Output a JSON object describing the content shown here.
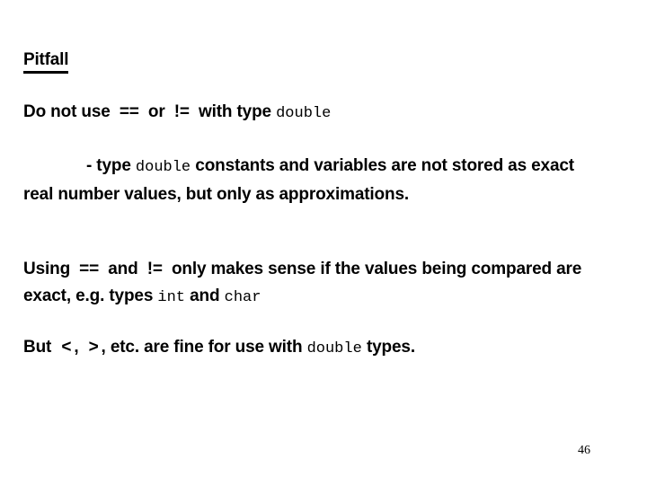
{
  "slide": {
    "heading": "Pitfall",
    "page_number": "46",
    "background_color": "#ffffff",
    "text_color": "#000000"
  },
  "body": {
    "line1": {
      "prefix": "Do not use",
      "op1": "==",
      "mid": "or",
      "op2": "!=",
      "suffix": "with type",
      "code1": "double"
    },
    "paragraph1": {
      "dash_prefix": "- type",
      "code1": "double",
      "text": "constants and variables are not stored as exact real number values, but only as approximations."
    },
    "paragraph2": {
      "prefix": "Using",
      "op1": "==",
      "mid": "and",
      "op2": "!=",
      "text": "only makes sense if the values being compared are exact, e.g. types",
      "code1": "int",
      "conjunction": "and",
      "code2": "char"
    },
    "paragraph3": {
      "prefix": "But",
      "op1": "<",
      "comma1": ",",
      "op2": ">",
      "comma2": ",",
      "text": "etc. are fine for use with",
      "code1": "double",
      "suffix": "types."
    }
  }
}
